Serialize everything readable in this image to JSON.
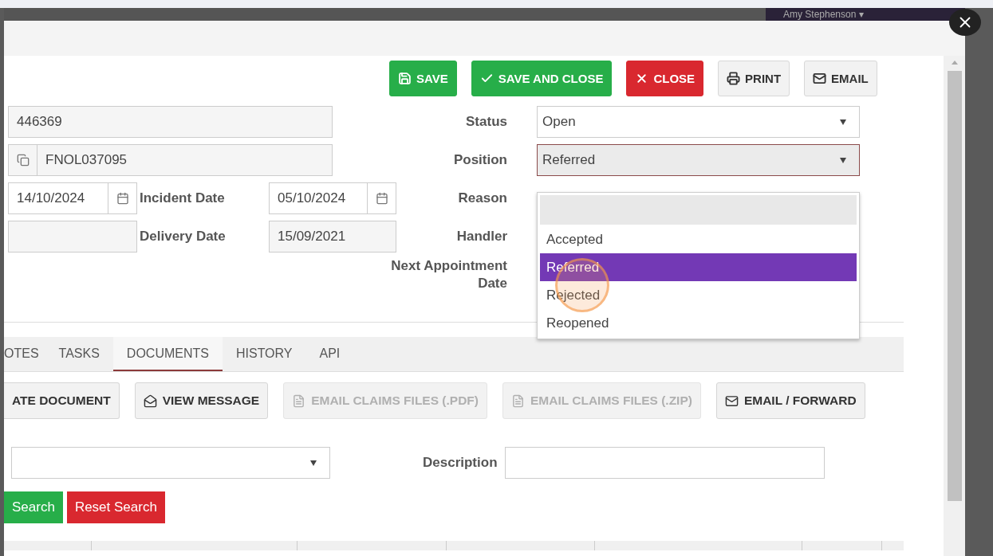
{
  "top_bar": {
    "user": "Amy Stephenson ▾"
  },
  "toolbar": [
    {
      "label": "SAVE",
      "kind": "save"
    },
    {
      "label": "SAVE AND CLOSE",
      "kind": "confirm"
    },
    {
      "label": "CLOSE",
      "kind": "cancel"
    },
    {
      "label": "PRINT",
      "kind": "print"
    },
    {
      "label": "EMAIL",
      "kind": "email"
    }
  ],
  "form": {
    "claim_id": {
      "value": "446369"
    },
    "reference": {
      "value": "FNOL037095"
    },
    "left_date": {
      "value": "14/10/2024"
    },
    "incident_date": {
      "label": "Incident Date",
      "value": "05/10/2024"
    },
    "delivery_date": {
      "label": "Delivery Date",
      "value": "15/09/2021"
    },
    "status": {
      "label": "Status",
      "value": "Open"
    },
    "position": {
      "label": "Position",
      "value": "Referred",
      "expanded": true,
      "options": [
        {
          "kind": "blank",
          "selected": false
        },
        {
          "kind": "option",
          "label": "Accepted",
          "selected": false
        },
        {
          "kind": "option",
          "label": "Referred",
          "selected": true
        },
        {
          "kind": "option",
          "label": "Rejected",
          "selected": false
        },
        {
          "kind": "option",
          "label": "Reopened",
          "selected": false
        }
      ]
    },
    "reason": {
      "label": "Reason"
    },
    "handler": {
      "label": "Handler"
    },
    "next_appointment": {
      "label": "Next Appointment Date"
    }
  },
  "tabs": [
    {
      "label": "OTES",
      "selected": false
    },
    {
      "label": "TASKS",
      "selected": false
    },
    {
      "label": "DOCUMENTS",
      "selected": true
    },
    {
      "label": "HISTORY",
      "selected": false
    },
    {
      "label": "API",
      "selected": false
    }
  ],
  "document_actions": [
    {
      "label": "ATE DOCUMENT",
      "kind": "plain",
      "disabled": false
    },
    {
      "label": "VIEW MESSAGE",
      "kind": "message",
      "disabled": false
    },
    {
      "label": "EMAIL CLAIMS FILES (.PDF)",
      "kind": "file",
      "disabled": true
    },
    {
      "label": "EMAIL CLAIMS FILES (.ZIP)",
      "kind": "file",
      "disabled": true
    },
    {
      "label": "EMAIL / FORWARD",
      "kind": "mail",
      "disabled": false
    }
  ],
  "search": {
    "description_label": "Description",
    "buttons": [
      {
        "label": "Search",
        "kind": "go"
      },
      {
        "label": "Reset Search",
        "kind": "reset"
      }
    ]
  }
}
